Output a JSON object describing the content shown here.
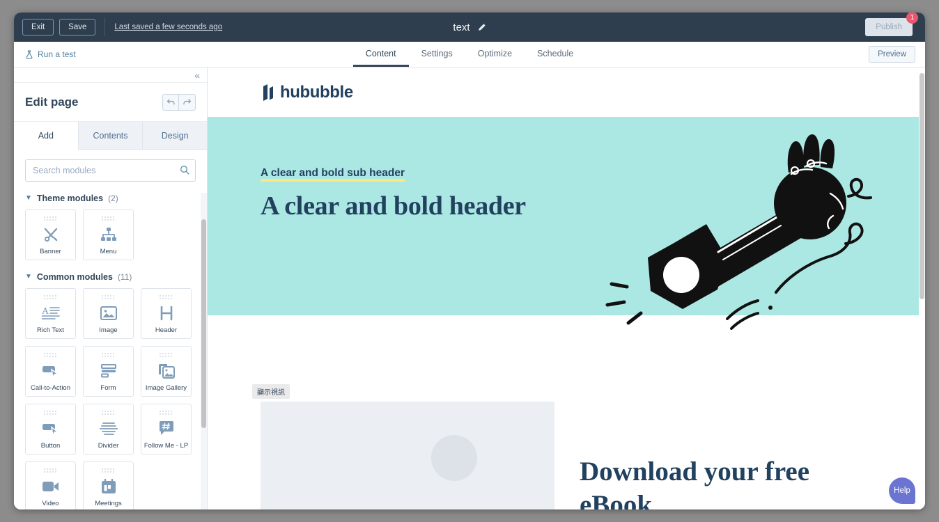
{
  "topbar": {
    "exit_label": "Exit",
    "save_label": "Save",
    "saved_status": "Last saved a few seconds ago",
    "page_title": "text",
    "edit_title_icon": "pencil-icon",
    "publish_label": "Publish",
    "publish_badge": "1"
  },
  "subbar": {
    "run_test_label": "Run a test",
    "run_test_icon": "flask-icon",
    "tabs": [
      {
        "label": "Content",
        "active": true
      },
      {
        "label": "Settings",
        "active": false
      },
      {
        "label": "Optimize",
        "active": false
      },
      {
        "label": "Schedule",
        "active": false
      }
    ],
    "preview_label": "Preview"
  },
  "sidebar": {
    "collapse_icon": "chevron-double-left-icon",
    "heading": "Edit page",
    "undo_icon": "undo-icon",
    "redo_icon": "redo-icon",
    "tabs": [
      {
        "label": "Add",
        "active": true
      },
      {
        "label": "Contents",
        "active": false
      },
      {
        "label": "Design",
        "active": false
      }
    ],
    "search": {
      "placeholder": "Search modules",
      "value": "",
      "icon": "search-icon"
    },
    "groups": [
      {
        "title": "Theme modules",
        "count": "(2)",
        "modules": [
          {
            "label": "Banner",
            "icon": "tools-icon"
          },
          {
            "label": "Menu",
            "icon": "sitemap-icon"
          }
        ]
      },
      {
        "title": "Common modules",
        "count": "(11)",
        "modules": [
          {
            "label": "Rich Text",
            "icon": "rich-text-icon"
          },
          {
            "label": "Image",
            "icon": "image-icon"
          },
          {
            "label": "Header",
            "icon": "header-h-icon"
          },
          {
            "label": "Call-to-Action",
            "icon": "cta-cursor-icon"
          },
          {
            "label": "Form",
            "icon": "form-icon"
          },
          {
            "label": "Image Gallery",
            "icon": "image-gallery-icon"
          },
          {
            "label": "Button",
            "icon": "button-cursor-icon"
          },
          {
            "label": "Divider",
            "icon": "divider-icon"
          },
          {
            "label": "Follow Me - LP",
            "icon": "hashtag-bubble-icon"
          },
          {
            "label": "Video",
            "icon": "video-camera-icon"
          },
          {
            "label": "Meetings",
            "icon": "calendar-icon"
          }
        ]
      }
    ]
  },
  "canvas": {
    "logo_text": "hububble",
    "hero": {
      "sub_header": "A clear and bold sub header",
      "main_header": "A clear and bold header",
      "background_color": "#ace8e3",
      "underline_color": "#fbe87f",
      "illustration": "hand-holding-wrench-illustration"
    },
    "video_badge": "顯示視訊",
    "lower": {
      "image_placeholder": "image-placeholder",
      "heading": "Download your free eBook"
    },
    "help_label": "Help",
    "help_color": "#6b75d1"
  }
}
